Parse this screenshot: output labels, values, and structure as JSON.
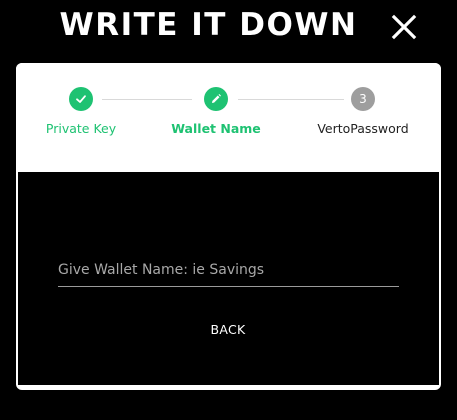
{
  "header": {
    "title": "WRITE IT DOWN",
    "close_icon": "close-icon"
  },
  "stepper": {
    "steps": [
      {
        "label": "Private Key",
        "state": "done",
        "icon": "check-icon"
      },
      {
        "label": "Wallet Name",
        "state": "active",
        "icon": "pencil-icon"
      },
      {
        "label": "VertoPassword",
        "state": "pending",
        "number": "3"
      }
    ]
  },
  "form": {
    "wallet_name_placeholder": "Give Wallet Name: ie Savings",
    "wallet_name_value": "",
    "back_label": "BACK"
  },
  "colors": {
    "background": "#000000",
    "card": "#ffffff",
    "accent_green": "#1ec272",
    "pending_gray": "#9e9e9e"
  }
}
